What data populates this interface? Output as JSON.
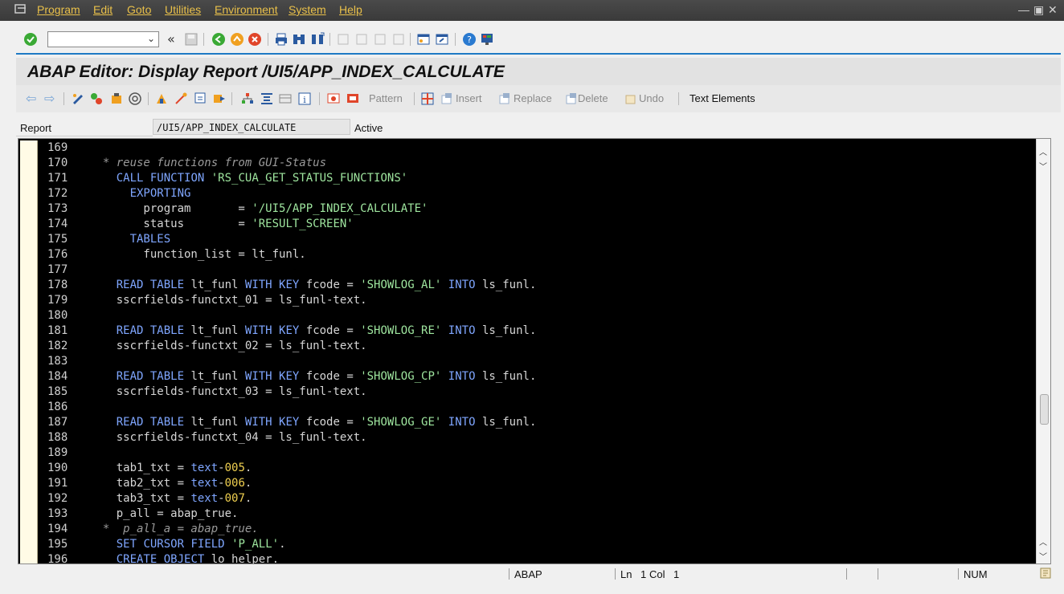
{
  "menu": [
    "Program",
    "Edit",
    "Goto",
    "Utilities",
    "Environment",
    "System",
    "Help"
  ],
  "command_field": {
    "value": ""
  },
  "title": "ABAP Editor: Display Report /UI5/APP_INDEX_CALCULATE",
  "app_toolbar": {
    "pattern": "Pattern",
    "insert": "Insert",
    "replace": "Replace",
    "delete": "Delete",
    "undo": "Undo",
    "text_elements": "Text Elements"
  },
  "report": {
    "label": "Report",
    "value": "/UI5/APP_INDEX_CALCULATE",
    "status": "Active"
  },
  "code_lines": [
    {
      "n": "169",
      "t": ""
    },
    {
      "n": "170",
      "t": "  * reuse functions from GUI-Status"
    },
    {
      "n": "171",
      "t": "    CALL FUNCTION 'RS_CUA_GET_STATUS_FUNCTIONS'"
    },
    {
      "n": "172",
      "t": "      EXPORTING"
    },
    {
      "n": "173",
      "t": "        program       = '/UI5/APP_INDEX_CALCULATE'"
    },
    {
      "n": "174",
      "t": "        status        = 'RESULT_SCREEN'"
    },
    {
      "n": "175",
      "t": "      TABLES"
    },
    {
      "n": "176",
      "t": "        function_list = lt_funl."
    },
    {
      "n": "177",
      "t": ""
    },
    {
      "n": "178",
      "t": "    READ TABLE lt_funl WITH KEY fcode = 'SHOWLOG_AL' INTO ls_funl."
    },
    {
      "n": "179",
      "t": "    sscrfields-functxt_01 = ls_funl-text."
    },
    {
      "n": "180",
      "t": ""
    },
    {
      "n": "181",
      "t": "    READ TABLE lt_funl WITH KEY fcode = 'SHOWLOG_RE' INTO ls_funl."
    },
    {
      "n": "182",
      "t": "    sscrfields-functxt_02 = ls_funl-text."
    },
    {
      "n": "183",
      "t": ""
    },
    {
      "n": "184",
      "t": "    READ TABLE lt_funl WITH KEY fcode = 'SHOWLOG_CP' INTO ls_funl."
    },
    {
      "n": "185",
      "t": "    sscrfields-functxt_03 = ls_funl-text."
    },
    {
      "n": "186",
      "t": ""
    },
    {
      "n": "187",
      "t": "    READ TABLE lt_funl WITH KEY fcode = 'SHOWLOG_GE' INTO ls_funl."
    },
    {
      "n": "188",
      "t": "    sscrfields-functxt_04 = ls_funl-text."
    },
    {
      "n": "189",
      "t": ""
    },
    {
      "n": "190",
      "t": "    tab1_txt = text-005."
    },
    {
      "n": "191",
      "t": "    tab2_txt = text-006."
    },
    {
      "n": "192",
      "t": "    tab3_txt = text-007."
    },
    {
      "n": "193",
      "t": "    p_all = abap_true."
    },
    {
      "n": "194",
      "t": "  *  p_all_a = abap_true."
    },
    {
      "n": "195",
      "t": "    SET CURSOR FIELD 'P_ALL'."
    },
    {
      "n": "196",
      "t": "    CREATE OBJECT lo_helper."
    }
  ],
  "status_bar": {
    "language": "ABAP",
    "ln_label": "Ln",
    "ln_value": "1",
    "col_label": "Col",
    "col_value": "1",
    "num": "NUM"
  },
  "colors": {
    "menu_text": "#e9c04a",
    "editor_bg": "#000000",
    "keyword": "#7fa6ff",
    "string": "#9fe69f",
    "comment": "#9a9a9a",
    "accent_line": "#1e7ac4"
  }
}
